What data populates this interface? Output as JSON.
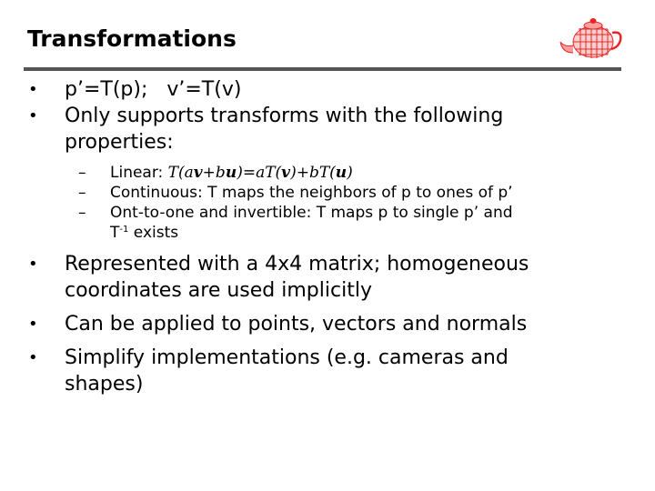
{
  "slide": {
    "title": "Transformations",
    "logo_icon": "teapot-wireframe-icon",
    "accent_color": "#ee2222",
    "rule_color": "#555555",
    "bullets": [
      {
        "text": "p’=T(p);   v’=T(v)"
      },
      {
        "text": "Only supports transforms with the following properties:",
        "line1": "Only supports transforms with the following",
        "line2": "properties:",
        "sub": [
          {
            "label": "Linear: ",
            "formula": {
              "part1": "T(a",
              "v1": "v",
              "part2": "+b",
              "u1": "u",
              "part3": ")=aT(",
              "v2": "v",
              "part4": ")+bT(",
              "u2": "u",
              "part5": ")"
            }
          },
          {
            "text": "Continuous: T maps the neighbors of p to ones of p’"
          },
          {
            "line1": "Ont-to-one and invertible: T maps p to single p’ and",
            "line2_pre": "T",
            "line2_sup": "-1",
            "line2_post": " exists"
          }
        ]
      },
      {
        "line1": "Represented with a 4x4 matrix; homogeneous",
        "line2": "coordinates are used implicitly"
      },
      {
        "text": "Can be applied to points, vectors and normals"
      },
      {
        "line1": "Simplify implementations (e.g. cameras and",
        "line2": "shapes)"
      }
    ],
    "bullet_glyph": "•",
    "dash_glyph": "–"
  }
}
